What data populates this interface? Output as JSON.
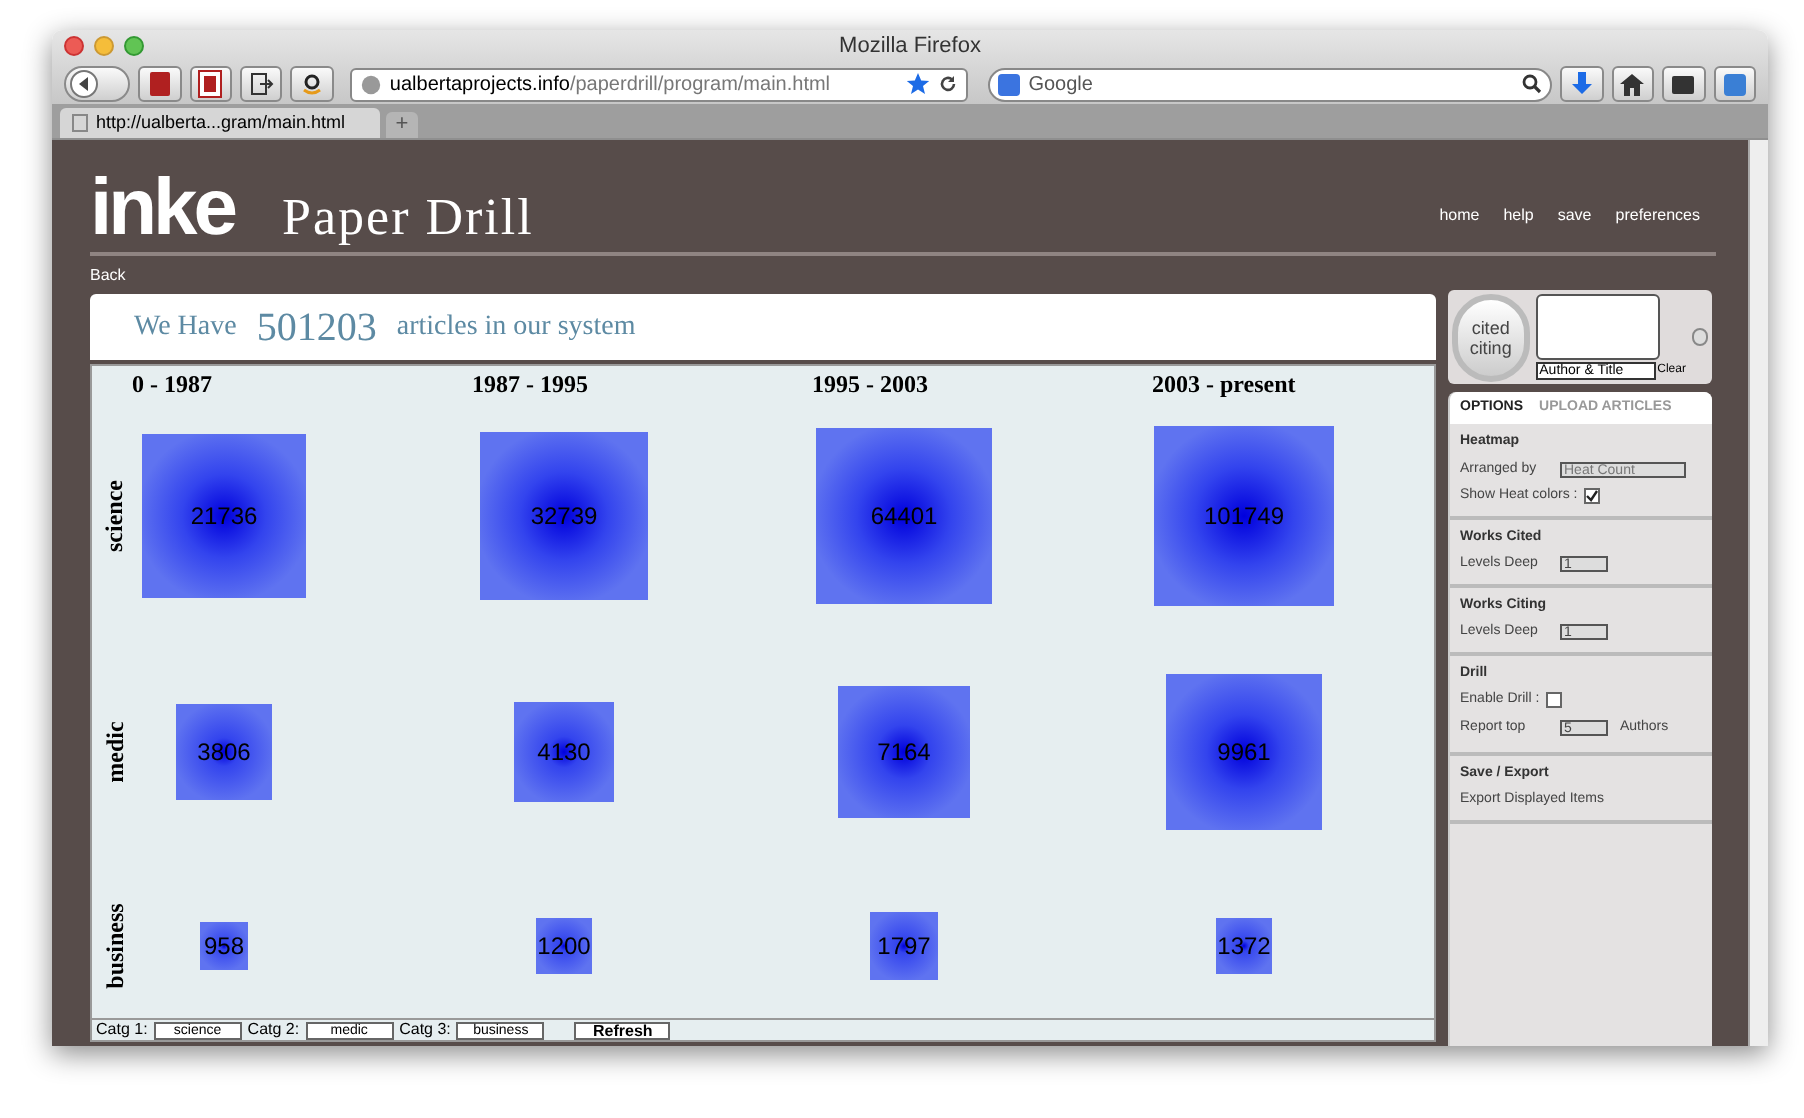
{
  "window": {
    "title": "Mozilla Firefox"
  },
  "toolbar": {
    "url_host": "ualbertaprojects.info",
    "url_path": "/paperdrill/program/main.html",
    "search_placeholder": "Google"
  },
  "tabs": [
    {
      "label": "http://ualberta...gram/main.html",
      "selected": true
    }
  ],
  "tab_add": "+",
  "app": {
    "logo": "inke",
    "title": "Paper Drill",
    "nav": [
      "home",
      "help",
      "save",
      "preferences"
    ],
    "back": "Back"
  },
  "banner": {
    "prefix": "We Have",
    "count": "501203",
    "suffix": "articles in our system"
  },
  "heatmap": {
    "columns": [
      "0 - 1987",
      "1987 - 1995",
      "1995 - 2003",
      "2003 - present"
    ],
    "rows": [
      {
        "label": "science",
        "cells": [
          {
            "value": "21736"
          },
          {
            "value": "32739"
          },
          {
            "value": "64401"
          },
          {
            "value": "101749"
          }
        ]
      },
      {
        "label": "medic",
        "cells": [
          {
            "value": "3806"
          },
          {
            "value": "4130"
          },
          {
            "value": "7164"
          },
          {
            "value": "9961"
          }
        ]
      },
      {
        "label": "business",
        "cells": [
          {
            "value": "958"
          },
          {
            "value": "1200"
          },
          {
            "value": "1797"
          },
          {
            "value": "1372"
          }
        ]
      }
    ]
  },
  "category_bar": {
    "fields": [
      {
        "label": "Catg 1:",
        "value": "science"
      },
      {
        "label": "Catg 2:",
        "value": "medic"
      },
      {
        "label": "Catg 3:",
        "value": "business"
      }
    ],
    "button": "Refresh"
  },
  "search_widget": {
    "toggle_top": "cited",
    "toggle_bottom": "citing",
    "mode": "Author & Title",
    "clear": "Clear"
  },
  "sidebar": {
    "tabs": [
      {
        "label": "OPTIONS",
        "selected": true
      },
      {
        "label": "UPLOAD ARTICLES",
        "selected": false
      }
    ],
    "sections": [
      {
        "title": "Heatmap",
        "rows": [
          {
            "kind": "select",
            "label": "Arranged by",
            "value": "Heat Count"
          },
          {
            "kind": "checkbox",
            "label": "Show Heat colors :",
            "checked": true
          }
        ]
      },
      {
        "title": "Works Cited",
        "rows": [
          {
            "kind": "select",
            "label": "Levels Deep",
            "value": "1"
          }
        ]
      },
      {
        "title": "Works Citing",
        "rows": [
          {
            "kind": "select",
            "label": "Levels Deep",
            "value": "1"
          }
        ]
      },
      {
        "title": "Drill",
        "rows": [
          {
            "kind": "checkbox",
            "label": "Enable Drill :",
            "checked": false
          },
          {
            "kind": "select",
            "label": "Report top",
            "value": "5",
            "suffix": "Authors"
          }
        ]
      },
      {
        "title": "Save / Export",
        "rows": [
          {
            "kind": "text",
            "label": "Export Displayed Items"
          }
        ]
      }
    ]
  }
}
